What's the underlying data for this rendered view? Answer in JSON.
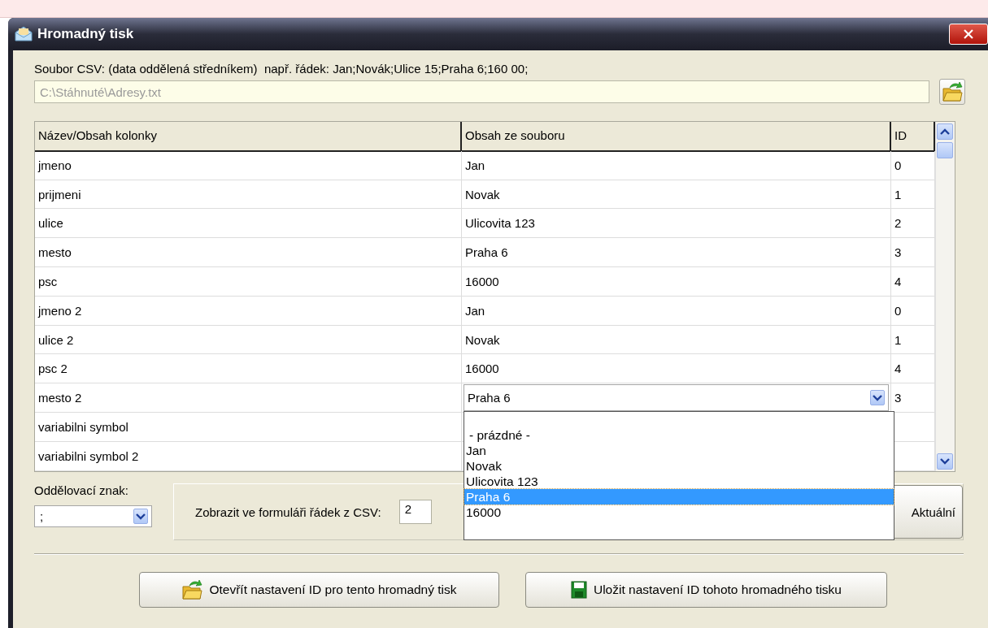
{
  "window": {
    "title": "Hromadný tisk"
  },
  "csv_file": {
    "label": "Soubor CSV: (data oddělená středníkem)  např. řádek: Jan;Novák;Ulice 15;Praha 6;160 00;",
    "value": "C:\\Stáhnuté\\Adresy.txt",
    "disabled": true
  },
  "table": {
    "columns": [
      "Název/Obsah kolonky",
      "Obsah ze souboru",
      "ID"
    ],
    "rows": [
      {
        "kind": "text",
        "name": "jmeno",
        "content": "Jan",
        "id": "0"
      },
      {
        "kind": "text",
        "name": "prijmeni",
        "content": "Novak",
        "id": "1"
      },
      {
        "kind": "text",
        "name": "ulice",
        "content": "Ulicovita 123",
        "id": "2"
      },
      {
        "kind": "text",
        "name": "mesto",
        "content": "Praha 6",
        "id": "3"
      },
      {
        "kind": "text",
        "name": "psc",
        "content": "16000",
        "id": "4"
      },
      {
        "kind": "text",
        "name": "jmeno 2",
        "content": "Jan",
        "id": "0"
      },
      {
        "kind": "text",
        "name": "ulice 2",
        "content": "Novak",
        "id": "1"
      },
      {
        "kind": "text",
        "name": "psc 2",
        "content": "16000",
        "id": "4"
      },
      {
        "kind": "combo",
        "name": "mesto 2",
        "content": "Praha 6",
        "id": "3"
      },
      {
        "kind": "text",
        "name": "variabilni symbol"
      },
      {
        "kind": "text",
        "name": "variabilni symbol 2"
      }
    ]
  },
  "dropdown": {
    "options": [
      {
        "kind": "empty",
        "label": "- prázdné -",
        "selected": false
      },
      {
        "kind": "value",
        "label": "Jan",
        "selected": false
      },
      {
        "kind": "value",
        "label": "Novak",
        "selected": false
      },
      {
        "kind": "value",
        "label": "Ulicovita 123",
        "selected": false
      },
      {
        "kind": "value",
        "label": "Praha 6",
        "selected": true
      },
      {
        "kind": "value",
        "label": "16000",
        "selected": false
      }
    ]
  },
  "separator": {
    "label": "Oddělovací znak:",
    "value": ";"
  },
  "row_picker": {
    "label": "Zobrazit ve formuláři řádek z CSV:",
    "value": "2",
    "button": "Aktuální"
  },
  "buttons": [
    {
      "kind": "open",
      "label": "Otevřít nastavení ID pro tento hromadný tisk"
    },
    {
      "kind": "save",
      "label": "Uložit nastavení ID tohoto hromadného tisku"
    }
  ]
}
